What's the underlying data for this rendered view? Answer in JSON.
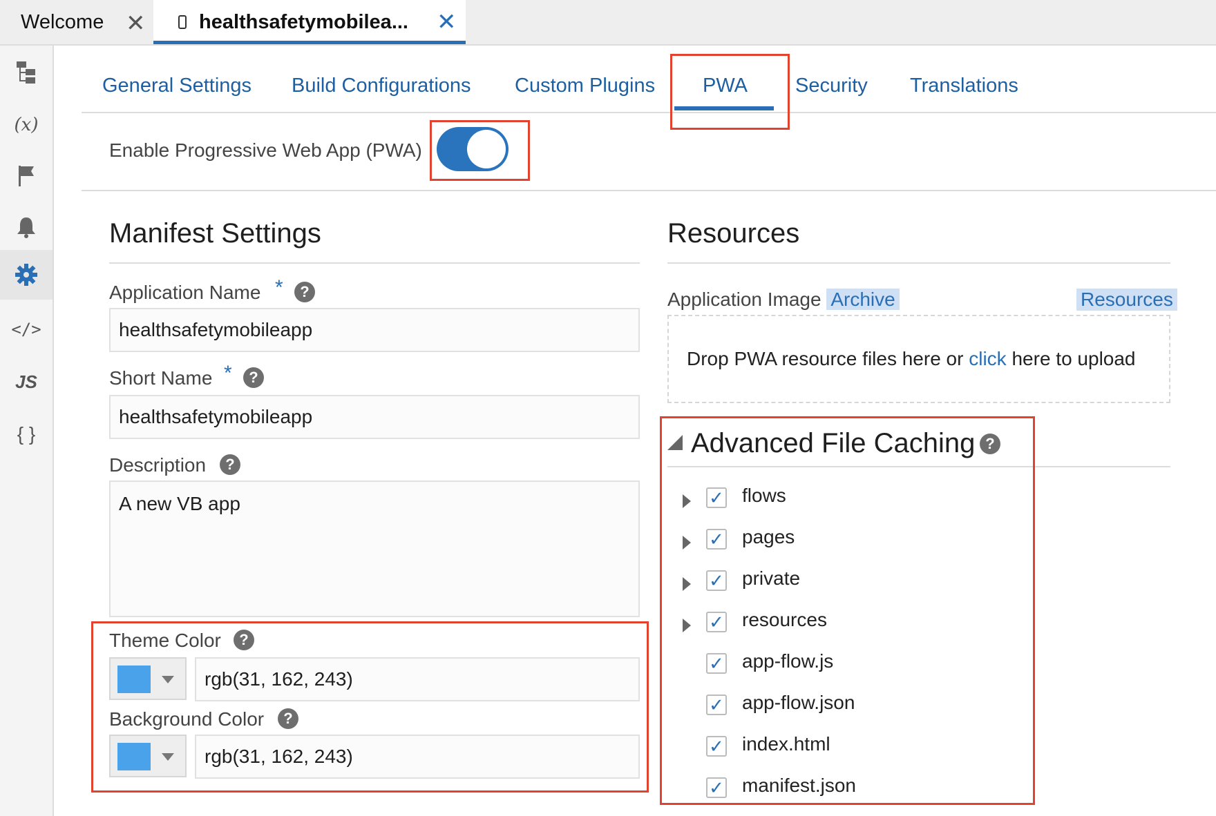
{
  "file_tabs": [
    {
      "label": "Welcome",
      "close": "✕"
    },
    {
      "label": "healthsafetymobilea...",
      "close": "✕"
    }
  ],
  "rail_icons": [
    "flow-icon",
    "variables-icon",
    "flag-icon",
    "bell-icon",
    "gear-icon",
    "code-icon",
    "js-icon",
    "json-icon"
  ],
  "rail_glyphs": {
    "variables": "(x)",
    "code": "</>",
    "js": "JS",
    "json": "{ }"
  },
  "subtabs": [
    "General Settings",
    "Build Configurations",
    "Custom Plugins",
    "PWA",
    "Security",
    "Translations"
  ],
  "active_subtab": "PWA",
  "pwa_toggle": {
    "label": "Enable Progressive Web App (PWA)",
    "on": true
  },
  "manifest": {
    "title": "Manifest Settings",
    "app_name_label": "Application Name",
    "app_name_value": "healthsafetymobileapp",
    "short_name_label": "Short Name",
    "short_name_value": "healthsafetymobileapp",
    "description_label": "Description",
    "description_value": "A new VB app",
    "theme_color_label": "Theme Color",
    "theme_color_value": "rgb(31, 162, 243)",
    "background_color_label": "Background Color",
    "background_color_value": "rgb(31, 162, 243)",
    "required_mark": "*",
    "help_glyph": "?"
  },
  "resources": {
    "title": "Resources",
    "image_label": "Application Image",
    "archive_link": "Archive",
    "resources_link": "Resources",
    "drop_text_1": "Drop PWA resource files here or",
    "drop_link": "click",
    "drop_text_2": "here to upload"
  },
  "caching": {
    "title": "Advanced File Caching",
    "items": [
      {
        "label": "flows",
        "checked": true,
        "expandable": true
      },
      {
        "label": "pages",
        "checked": true,
        "expandable": true
      },
      {
        "label": "private",
        "checked": true,
        "expandable": true
      },
      {
        "label": "resources",
        "checked": true,
        "expandable": true
      },
      {
        "label": "app-flow.js",
        "checked": true,
        "expandable": false
      },
      {
        "label": "app-flow.json",
        "checked": true,
        "expandable": false
      },
      {
        "label": "index.html",
        "checked": true,
        "expandable": false
      },
      {
        "label": "manifest.json",
        "checked": true,
        "expandable": false
      }
    ],
    "check_glyph": "✓"
  },
  "colors": {
    "accent": "#2a6fb6",
    "swatch": "#4aa3ea",
    "highlight_box": "#e2432f"
  }
}
